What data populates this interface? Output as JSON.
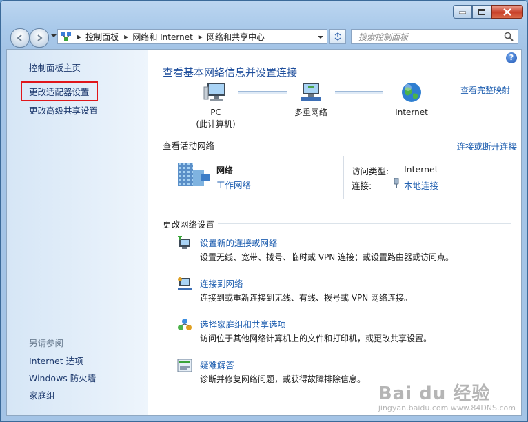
{
  "titlebar": {
    "buttons": [
      "minimize",
      "maximize",
      "close"
    ]
  },
  "address_bar": {
    "crumbs": [
      "控制面板",
      "网络和 Internet",
      "网络和共享中心"
    ]
  },
  "search": {
    "placeholder": "搜索控制面板"
  },
  "sidebar": {
    "links": [
      "控制面板主页",
      "更改适配器设置",
      "更改高级共享设置"
    ],
    "see_also_heading": "另请参阅",
    "see_also": [
      "Internet 选项",
      "Windows 防火墙",
      "家庭组"
    ]
  },
  "main": {
    "title": "查看基本网络信息并设置连接",
    "full_map_link": "查看完整映射",
    "map_nodes": [
      {
        "line1": "PC",
        "line2": "(此计算机)"
      },
      {
        "line1": "多重网络",
        "line2": ""
      },
      {
        "line1": "Internet",
        "line2": ""
      }
    ],
    "active_heading": "查看活动网络",
    "connect_disconnect_link": "连接或断开连接",
    "network": {
      "name": "网络",
      "category": "工作网络",
      "access_type_label": "访问类型:",
      "access_type_value": "Internet",
      "connection_label": "连接:",
      "connection_value": "本地连接"
    },
    "change_heading": "更改网络设置",
    "tasks": [
      {
        "title": "设置新的连接或网络",
        "desc": "设置无线、宽带、拨号、临时或 VPN 连接；或设置路由器或访问点。",
        "icon": "new-connection-icon"
      },
      {
        "title": "连接到网络",
        "desc": "连接到或重新连接到无线、有线、拨号或 VPN 网络连接。",
        "icon": "connect-network-icon"
      },
      {
        "title": "选择家庭组和共享选项",
        "desc": "访问位于其他网络计算机上的文件和打印机，或更改共享设置。",
        "icon": "homegroup-icon"
      },
      {
        "title": "疑难解答",
        "desc": "诊断并修复网络问题，或获得故障排除信息。",
        "icon": "troubleshoot-icon"
      }
    ]
  },
  "watermark": {
    "text": "Bai du 经验",
    "sub": "jingyan.baidu.com  www.84DNS.com"
  },
  "colors": {
    "link": "#1f5fb0",
    "title": "#1e4e9c",
    "highlight_box": "#e0161a",
    "sidebar_bg": "#dde9f6"
  }
}
